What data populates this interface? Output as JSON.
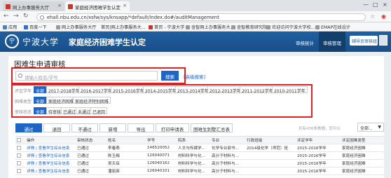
{
  "browser": {
    "tabs": [
      {
        "label": "网上办事服务大厅",
        "close": "×"
      },
      {
        "label": "家庭经济困难学生认定",
        "close": "×"
      }
    ],
    "window_controls": [
      "—",
      "□",
      "×"
    ],
    "url": "ehall.nbu.edu.cn/xsfw/sys/knsapp/*default/index.do#/auditManagement",
    "bookmarks": [
      "应用",
      "百度一下",
      "网上办事服务大厅",
      "首页|网上办事服务大...",
      "首页 - 宁波大学",
      "金智网上办事服务大...",
      "金智教育研究院",
      "欢迎访问宁波大学校...",
      "EMAP在线设计"
    ]
  },
  "app": {
    "seal_text": "宁",
    "logo": "宁波大学",
    "title": "家庭经济困难学生认定",
    "nav": [
      "审核统计",
      "审核管理"
    ],
    "user": "辅导员审核组 ▼"
  },
  "page": {
    "title": "困难生申请审核",
    "search_placeholder": "请输入姓名/学号",
    "search_button": "搜索",
    "advanced": "[高级搜索]"
  },
  "filters": {
    "year": {
      "label": "评定学年",
      "options": [
        "全部",
        "2017-2018学年",
        "2016-2017学年",
        "2015-2016学年",
        "2014-2015学年",
        "2013-2014学年",
        "2012-2013学年",
        "2011-2012学年",
        "2010-2011学年"
      ]
    },
    "category": {
      "label": "困难类型",
      "options": [
        "全部",
        "家庭经济困难",
        "家庭经济特别困难"
      ]
    },
    "status": {
      "label": "审核状态",
      "options": [
        "全部",
        "待审核",
        "已通过",
        "未通过",
        "已退回"
      ]
    }
  },
  "toolbar": {
    "buttons": [
      "通过",
      "退回",
      "不通过",
      "新增",
      "导出",
      "打印申请表",
      "困难生别墅汇总表"
    ],
    "pager_info": "共有436条数据，您可以",
    "page_select": "全部..."
  },
  "table": {
    "headers": [
      "",
      "操作",
      "审核状态",
      "姓名",
      "学号",
      "院系",
      "专业",
      "行政班级",
      "评定学年",
      "评定困难类型"
    ],
    "rows": [
      [
        "",
        "详情 | 查看学生综合信息",
        "已通过",
        "李春燕",
        "146520052",
        "人文与传媒学...",
        "化学专业部书...",
        "2014级化学（师范）班",
        "2015-2016学年",
        "家庭经济困难"
      ],
      [
        "",
        "详情 | 查看学生综合信息",
        "已通过",
        "陈玉梅",
        "126040071",
        "材料科学与化...",
        "高分子材料与...",
        "",
        "2015-2016学年",
        "家庭经济困难"
      ],
      [
        "",
        "详情 | 查看学生综合信息",
        "已通过",
        "吴天岳",
        "126040162",
        "材料科学与化...",
        "高分子材料与...",
        "",
        "2015-2016学年",
        "家庭经济困难"
      ],
      [
        "",
        "详情 | 查看学生综合信息",
        "已通过",
        "潘丽英",
        "126040101",
        "材料科学与化...",
        "高分子材料与...",
        "",
        "2015-2016学年",
        "家庭经济困难"
      ]
    ]
  }
}
